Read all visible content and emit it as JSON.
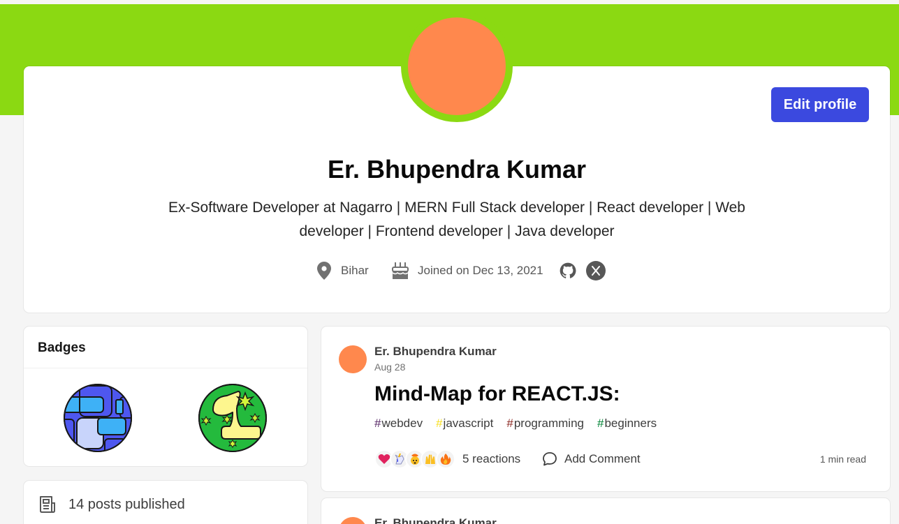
{
  "colors": {
    "banner": "#8bd912",
    "avatar": "#ff884d",
    "edit_button": "#3b49df",
    "icon_gray": "#717171"
  },
  "header": {
    "edit_button_label": "Edit profile"
  },
  "profile": {
    "name": "Er. Bhupendra Kumar",
    "bio_line1": "Ex-Software Developer at Nagarro | MERN Full Stack developer | React developer | Web",
    "bio_line2": "developer | Frontend developer | Java developer",
    "location": "Bihar",
    "joined": "Joined on Dec 13, 2021",
    "links": [
      {
        "icon": "github-icon"
      },
      {
        "icon": "x-icon"
      }
    ]
  },
  "sidebar": {
    "badges_title": "Badges",
    "badges": [
      {
        "icon": "writing-streak-badge-icon"
      },
      {
        "icon": "one-year-club-badge-icon"
      }
    ],
    "stats": [
      {
        "icon": "post-icon",
        "label": "14 posts published"
      }
    ]
  },
  "posts": [
    {
      "author": "Er. Bhupendra Kumar",
      "date": "Aug 28",
      "title": "Mind-Map for REACT.JS:",
      "tags": [
        {
          "hash": "#",
          "name": "webdev",
          "color": "#562765"
        },
        {
          "hash": "#",
          "name": "javascript",
          "color": "#f7df1e"
        },
        {
          "hash": "#",
          "name": "programming",
          "color": "#89251f"
        },
        {
          "hash": "#",
          "name": "beginners",
          "color": "#008335"
        }
      ],
      "reactions_label": "5 reactions",
      "comment_label": "Add Comment",
      "read_time": "1 min read",
      "reaction_icons": [
        "heart-icon",
        "unicorn-icon",
        "exploding-head-icon",
        "raised-hands-icon",
        "fire-icon"
      ]
    },
    {
      "author": "Er. Bhupendra Kumar"
    }
  ]
}
